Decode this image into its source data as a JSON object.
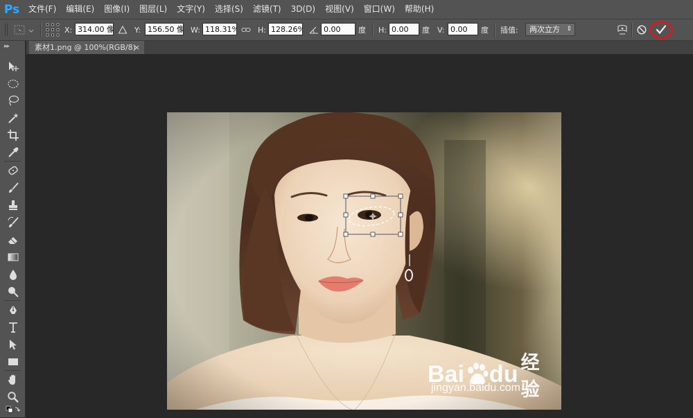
{
  "app": {
    "logo": "Ps"
  },
  "menu": [
    "文件(F)",
    "编辑(E)",
    "图像(I)",
    "图层(L)",
    "文字(Y)",
    "选择(S)",
    "滤镜(T)",
    "3D(D)",
    "视图(V)",
    "窗口(W)",
    "帮助(H)"
  ],
  "options": {
    "x_label": "X:",
    "x_value": "314.00 像",
    "y_label": "Y:",
    "y_value": "156.50 像",
    "w_label": "W:",
    "w_value": "118.31%",
    "h_label": "H:",
    "h_value": "128.26%",
    "angle_value": "0.00",
    "angle_unit": "度",
    "hskew_label": "H:",
    "hskew_value": "0.00",
    "hskew_unit": "度",
    "vskew_label": "V:",
    "vskew_value": "0.00",
    "vskew_unit": "度",
    "interp_label": "插值:",
    "interp_value": "两次立方"
  },
  "document": {
    "tab_title": "素材1.png @ 100%(RGB/8)",
    "close_glyph": "×"
  },
  "watermark": {
    "brand_a": "Bai",
    "brand_b": "du",
    "brand_cn": "经验",
    "url": "jingyan.baidu.com"
  },
  "colors": {
    "commit_highlight": "#e0161a",
    "logo": "#31a8ff"
  }
}
